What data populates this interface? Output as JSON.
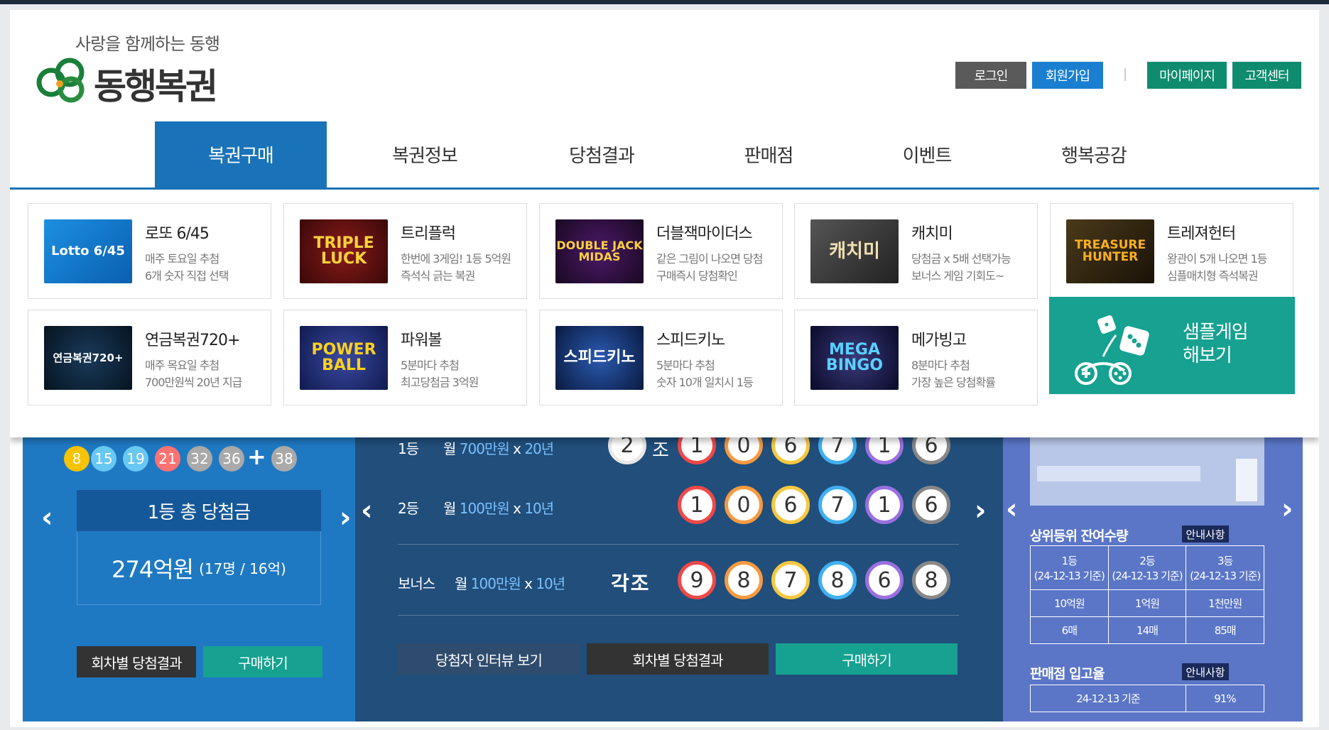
{
  "logo": {
    "tagline": "사랑을 함께하는 동행",
    "name": "동행복권"
  },
  "util": {
    "login": "로그인",
    "join": "회원가입",
    "mypage": "마이페이지",
    "support": "고객센터"
  },
  "nav": [
    {
      "label": "복권구매",
      "active": true
    },
    {
      "label": "복권정보"
    },
    {
      "label": "당첨결과"
    },
    {
      "label": "판매점"
    },
    {
      "label": "이벤트"
    },
    {
      "label": "행복공감"
    }
  ],
  "games": [
    {
      "title": "로또 6/45",
      "d1": "매주 토요일 추첨",
      "d2": "6개 숫자 직접 선택",
      "thumb": "Lotto 6/45"
    },
    {
      "title": "트리플럭",
      "d1": "한번에 3게임! 1등 5억원",
      "d2": "즉석식 긁는 복권",
      "thumb": "TRIPLE LUCK"
    },
    {
      "title": "더블잭마이더스",
      "d1": "같은 그림이 나오면 당첨",
      "d2": "구매즉시 당첨확인",
      "thumb": "DOUBLE JACK MIDAS"
    },
    {
      "title": "캐치미",
      "d1": "당첨금 x 5배 선택가능",
      "d2": "보너스 게임 기회도~",
      "thumb": "캐치미"
    },
    {
      "title": "트레져헌터",
      "d1": "왕관이 5개 나오면 1등",
      "d2": "심플매치형 즉석복권",
      "thumb": "TREASURE HUNTER"
    },
    {
      "title": "연금복권720+",
      "d1": "매주 목요일 추첨",
      "d2": "700만원씩 20년 지급",
      "thumb": "연금복권720+"
    },
    {
      "title": "파워볼",
      "d1": "5분마다 추첨",
      "d2": "최고당첨금 3억원",
      "thumb": "POWER BALL"
    },
    {
      "title": "스피드키노",
      "d1": "5분마다 추첨",
      "d2": "숫자 10개 일치시 1등",
      "thumb": "스피드키노"
    },
    {
      "title": "메가빙고",
      "d1": "8분마다 추첨",
      "d2": "가장 높은 당첨확률",
      "thumb": "MEGA BINGO"
    }
  ],
  "sample": {
    "line1": "샘플게임",
    "line2": "해보기"
  },
  "lotto": {
    "balls": [
      "8",
      "15",
      "19",
      "21",
      "32",
      "36"
    ],
    "plus": "+",
    "bonus": "38",
    "total_label": "1등 총 당첨금",
    "total_amount": "274억원",
    "total_sub": "(17명 / 16억)",
    "btn_results": "회차별 당첨결과",
    "btn_buy": "구매하기"
  },
  "pension": {
    "rank1": {
      "name": "1등",
      "pre": "월 ",
      "amt": "700만원",
      "mid": " x ",
      "yrs": "20년",
      "group": "2",
      "jo": "조",
      "digits": [
        "1",
        "0",
        "6",
        "7",
        "1",
        "6"
      ]
    },
    "rank2": {
      "name": "2등",
      "pre": "월 ",
      "amt": "100만원",
      "mid": " x ",
      "yrs": "10년",
      "digits": [
        "1",
        "0",
        "6",
        "7",
        "1",
        "6"
      ]
    },
    "bonus": {
      "name": "보너스",
      "pre": "월 ",
      "amt": "100만원",
      "mid": " x ",
      "yrs": "10년",
      "group": "각조",
      "digits": [
        "9",
        "8",
        "7",
        "8",
        "6",
        "8"
      ]
    },
    "btn_interview": "당첨자 인터뷰 보기",
    "btn_results": "회차별 당첨결과",
    "btn_buy": "구매하기"
  },
  "remaining": {
    "title": "상위등위 잔여수량",
    "note": "안내사항",
    "headers": [
      [
        "1등",
        "(24-12-13 기준)"
      ],
      [
        "2등",
        "(24-12-13 기준)"
      ],
      [
        "3등",
        "(24-12-13 기준)"
      ]
    ],
    "prizes": [
      "10억원",
      "1억원",
      "1천만원"
    ],
    "counts": [
      "6매",
      "14매",
      "85매"
    ]
  },
  "store": {
    "title": "판매점 입고율",
    "note": "안내사항",
    "date": "24-12-13 기준",
    "rate": "91%"
  },
  "colors": {
    "accent": "#1a73b8",
    "teal": "#16a190",
    "login": "#5a5a5a",
    "join": "#1a7fd0",
    "green": "#0f8c6e"
  }
}
